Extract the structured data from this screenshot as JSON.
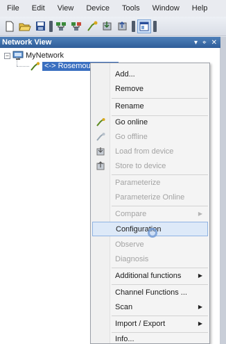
{
  "menubar": {
    "items": [
      "File",
      "Edit",
      "View",
      "Device",
      "Tools",
      "Window",
      "Help"
    ]
  },
  "toolbar": {
    "buttons": [
      "new-icon",
      "open-icon",
      "save-icon",
      "network-scan-icon",
      "network-config-icon",
      "go-online-icon",
      "load-from-device-icon",
      "store-to-device-icon",
      "network-view-icon"
    ]
  },
  "panel": {
    "title": "Network View",
    "controls": [
      "▾",
      "⌖",
      "✕"
    ]
  },
  "tree": {
    "root_label": "MyNetwork",
    "child_label": "<-> Rosemount HART Com DTM"
  },
  "context_menu": {
    "items": [
      {
        "label": "Add...",
        "enabled": true
      },
      {
        "label": "Remove",
        "enabled": true
      },
      {
        "label": "Rename",
        "enabled": true
      },
      {
        "label": "Go online",
        "enabled": true,
        "icon": "go-online-icon"
      },
      {
        "label": "Go offline",
        "enabled": false,
        "icon": "go-offline-icon"
      },
      {
        "label": "Load from device",
        "enabled": false,
        "icon": "load-from-device-icon"
      },
      {
        "label": "Store to device",
        "enabled": false,
        "icon": "store-to-device-icon"
      },
      {
        "label": "Parameterize",
        "enabled": false
      },
      {
        "label": "Parameterize Online",
        "enabled": false
      },
      {
        "label": "Compare",
        "enabled": false,
        "submenu": true
      },
      {
        "label": "Configuration",
        "enabled": true,
        "hovered": true
      },
      {
        "label": "Observe",
        "enabled": false
      },
      {
        "label": "Diagnosis",
        "enabled": false
      },
      {
        "label": "Additional functions",
        "enabled": true,
        "submenu": true
      },
      {
        "label": "Channel Functions ...",
        "enabled": true
      },
      {
        "label": "Scan",
        "enabled": true,
        "submenu": true
      },
      {
        "label": "Import / Export",
        "enabled": true,
        "submenu": true
      },
      {
        "label": "Info...",
        "enabled": true
      }
    ],
    "submenu_arrow": "▶"
  },
  "colors": {
    "panel_header": "#3a6aa8",
    "selection": "#3a6fc0",
    "menu_hover": "#dde9f8"
  }
}
